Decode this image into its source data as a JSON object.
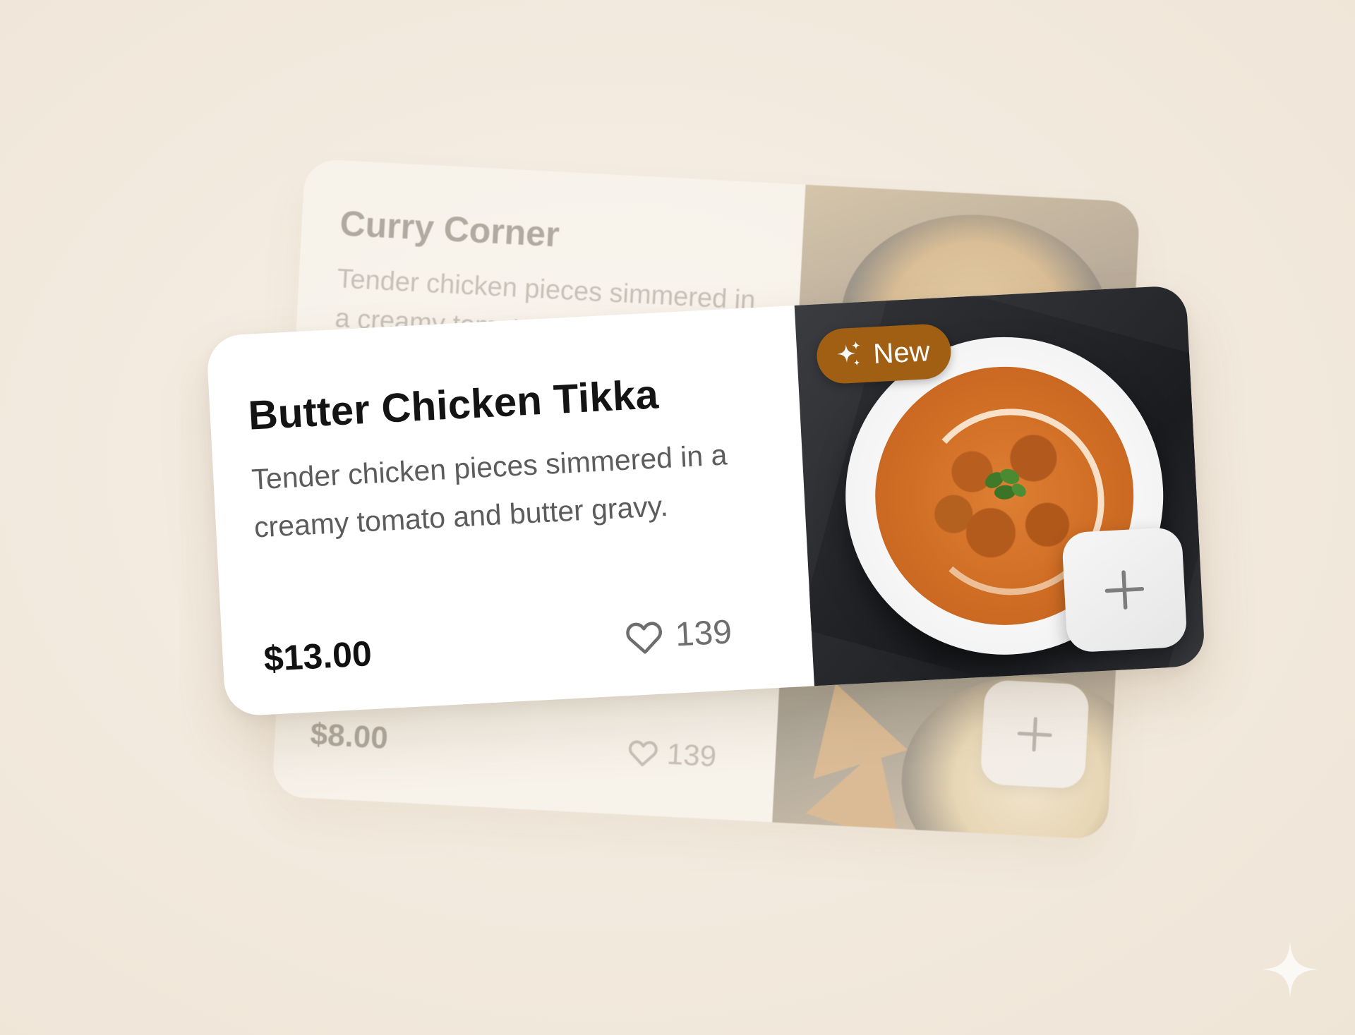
{
  "back_card": {
    "title": "Curry Corner",
    "description": "Tender chicken pieces simmered in a creamy tomato and butter gravy.",
    "price": "$8.00",
    "likes": "139",
    "add_icon": "plus-icon",
    "like_icon": "heart-icon"
  },
  "front_card": {
    "badge_label": "New",
    "badge_icon": "sparkle-icon",
    "title": "Butter Chicken Tikka",
    "description": "Tender chicken pieces simmered in a creamy tomato and butter gravy.",
    "price": "$13.00",
    "likes": "139",
    "add_icon": "plus-icon",
    "like_icon": "heart-icon"
  },
  "colors": {
    "background": "#f2e9dd",
    "badge": "#a15f14",
    "card": "#ffffff",
    "title_text": "#141414",
    "muted_text": "#5c5c5c"
  }
}
